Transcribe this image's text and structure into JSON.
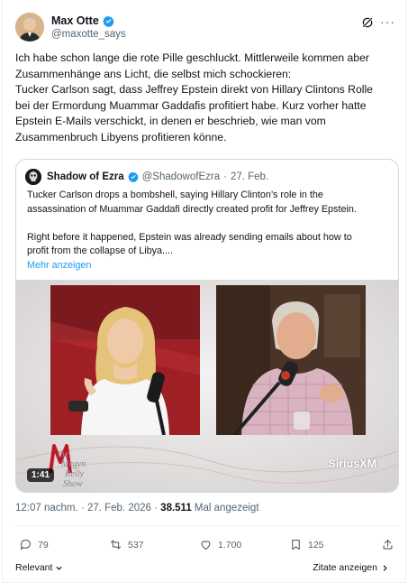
{
  "tweet": {
    "author_name": "Max Otte",
    "author_handle": "@maxotte_says",
    "text_lines": [
      "Ich habe schon lange die rote Pille geschluckt. Mittlerweile kommen aber",
      "Zusammenhänge ans Licht, die selbst mich schockieren:",
      "Tucker Carlson sagt, dass Jeffrey Epstein direkt von Hillary Clintons Rolle",
      "bei der Ermordung Muammar Gaddafis profitiert habe. Kurz vorher hatte",
      "Epstein E-Mails verschickt, in denen er beschrieb, wie man vom",
      "Zusammenbruch Libyens profitieren könne."
    ]
  },
  "quote": {
    "author_name": "Shadow of Ezra",
    "author_handle": "@ShadowofEzra",
    "separator": "·",
    "date": "27. Feb.",
    "text_lines_1": [
      "Tucker Carlson drops a bombshell, saying Hillary Clinton’s role in the",
      "assassination of Muammar Gaddafi directly created profit for Jeffrey Epstein."
    ],
    "text_lines_2": [
      "Right before it happened, Epstein was already sending emails about how to",
      "profit from the collapse of Libya...."
    ],
    "show_more": "Mehr anzeigen",
    "video": {
      "duration": "1:41",
      "watermark_left": [
        "the",
        "Megyn",
        "Kelly",
        "Show"
      ],
      "watermark_right": "SiriusXM"
    }
  },
  "meta": {
    "time": "12:07 nachm.",
    "dot": "·",
    "date": "27. Feb. 2026",
    "views": "38.511",
    "views_label": "Mal angezeigt"
  },
  "actions": {
    "replies": "79",
    "reposts": "537",
    "likes": "1.700",
    "bookmarks": "125"
  },
  "footer": {
    "relevant": "Relevant",
    "quotes": "Zitate anzeigen"
  },
  "colors": {
    "verified": "#1d9bf0",
    "link": "#1d9bf0",
    "secondary_text": "#536471"
  }
}
